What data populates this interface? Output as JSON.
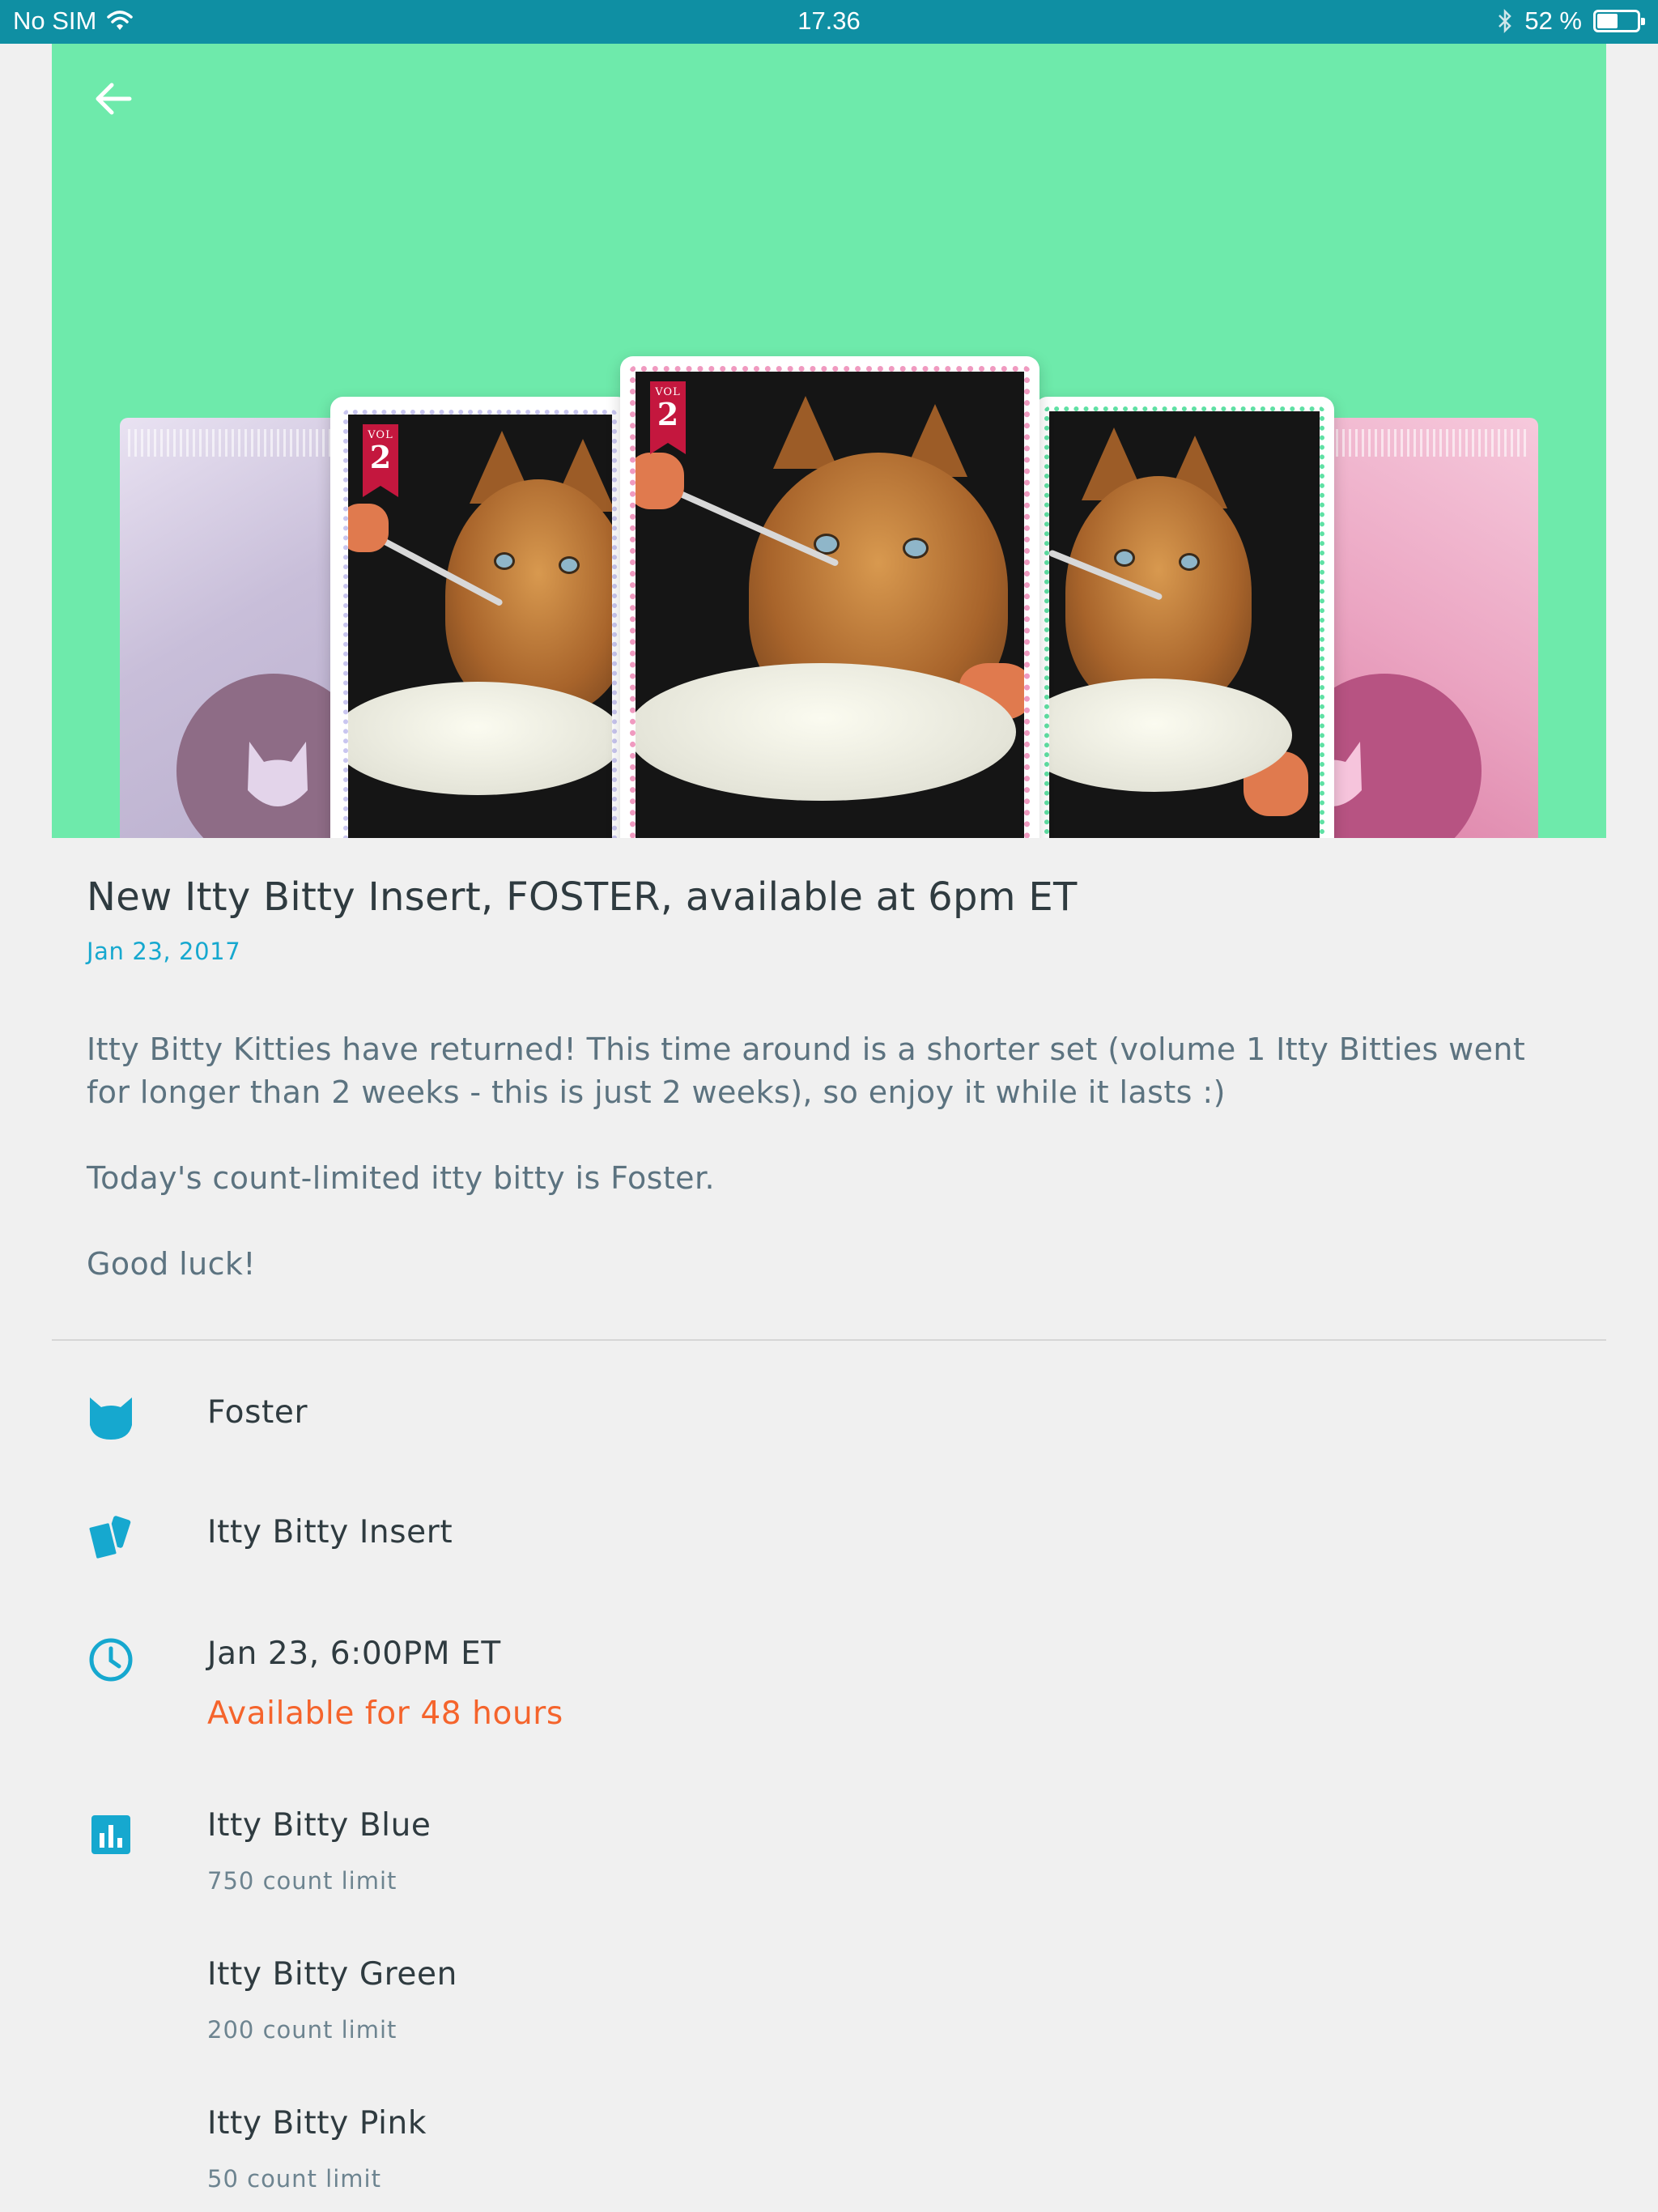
{
  "status_bar": {
    "carrier": "No SIM",
    "time": "17.36",
    "battery_percent_label": "52 %",
    "battery_level": 0.52,
    "icons": [
      "wifi-icon",
      "bluetooth-icon",
      "battery-icon"
    ]
  },
  "hero": {
    "background_color": "#6eeaab",
    "back_icon": "arrow-left-icon",
    "cards": [
      {
        "vol_label": "VOL",
        "vol_number": "2"
      },
      {
        "vol_label": "VOL",
        "vol_number": "2"
      },
      {
        "vol_label": "VOL",
        "vol_number": "2"
      }
    ]
  },
  "article": {
    "title": "New Itty Bitty Insert, FOSTER, available at 6pm ET",
    "date": "Jan 23, 2017",
    "paragraphs": [
      "Itty Bitty Kitties have returned! This time around is a shorter set (volume 1 Itty Bitties went for longer than 2 weeks - this is just 2 weeks), so enjoy it while it lasts :)",
      "Today's count-limited itty bitty is Foster.",
      "Good luck!"
    ]
  },
  "details": {
    "accent_color": "#16a8cf",
    "card_name": "Foster",
    "card_type": "Itty Bitty Insert",
    "release_time": "Jan 23, 6:00PM ET",
    "availability": "Available for 48 hours",
    "availability_color": "#f5642c",
    "variants": [
      {
        "name": "Itty Bitty Blue",
        "limit": "750 count limit"
      },
      {
        "name": "Itty Bitty Green",
        "limit": "200 count limit"
      },
      {
        "name": "Itty Bitty Pink",
        "limit": "50 count limit"
      }
    ]
  }
}
